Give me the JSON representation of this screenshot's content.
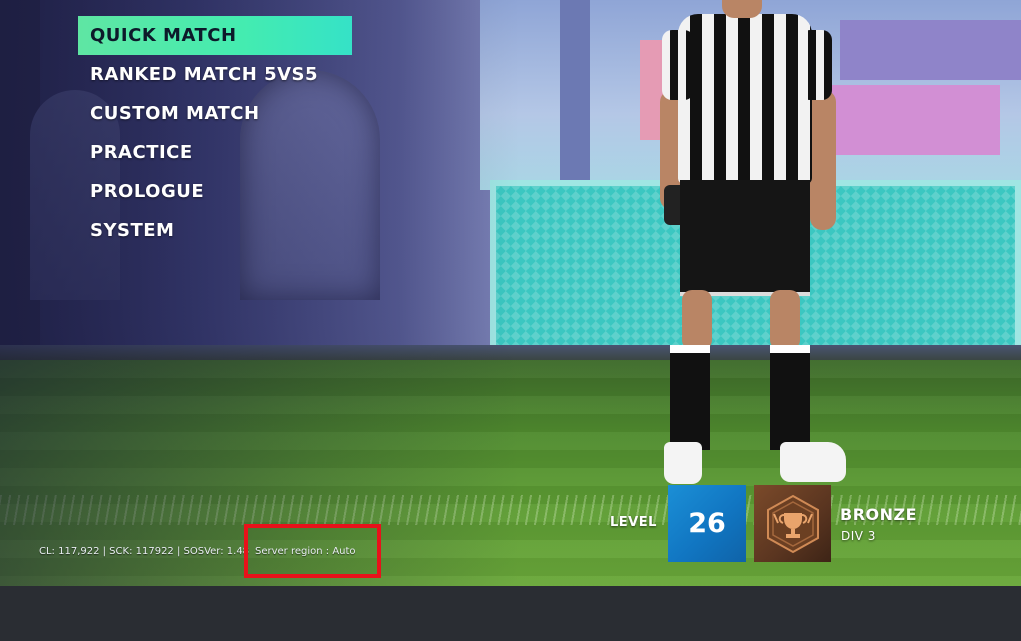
{
  "menu": {
    "items": [
      {
        "label": "QUICK MATCH",
        "selected": true
      },
      {
        "label": "RANKED MATCH 5VS5",
        "selected": false
      },
      {
        "label": "CUSTOM MATCH",
        "selected": false
      },
      {
        "label": "PRACTICE",
        "selected": false
      },
      {
        "label": "PROLOGUE",
        "selected": false
      },
      {
        "label": "SYSTEM",
        "selected": false
      }
    ]
  },
  "footer": {
    "build_info": "CL: 117,922 | SCK: 117922 | SOSVer: 1.48",
    "server_region": "Server region : Auto"
  },
  "profile": {
    "level_label": "LEVEL",
    "level": "26",
    "rank_name": "BRONZE",
    "rank_division": "DIV 3"
  },
  "colors": {
    "menu_highlight": "#44ecb0",
    "level_badge": "#1176c2",
    "rank_badge": "#5a3520",
    "annotation_box": "#e8121a",
    "bottom_bar": "#2a2d33"
  },
  "icons": {
    "rank_emblem": "trophy-emblem-icon"
  }
}
